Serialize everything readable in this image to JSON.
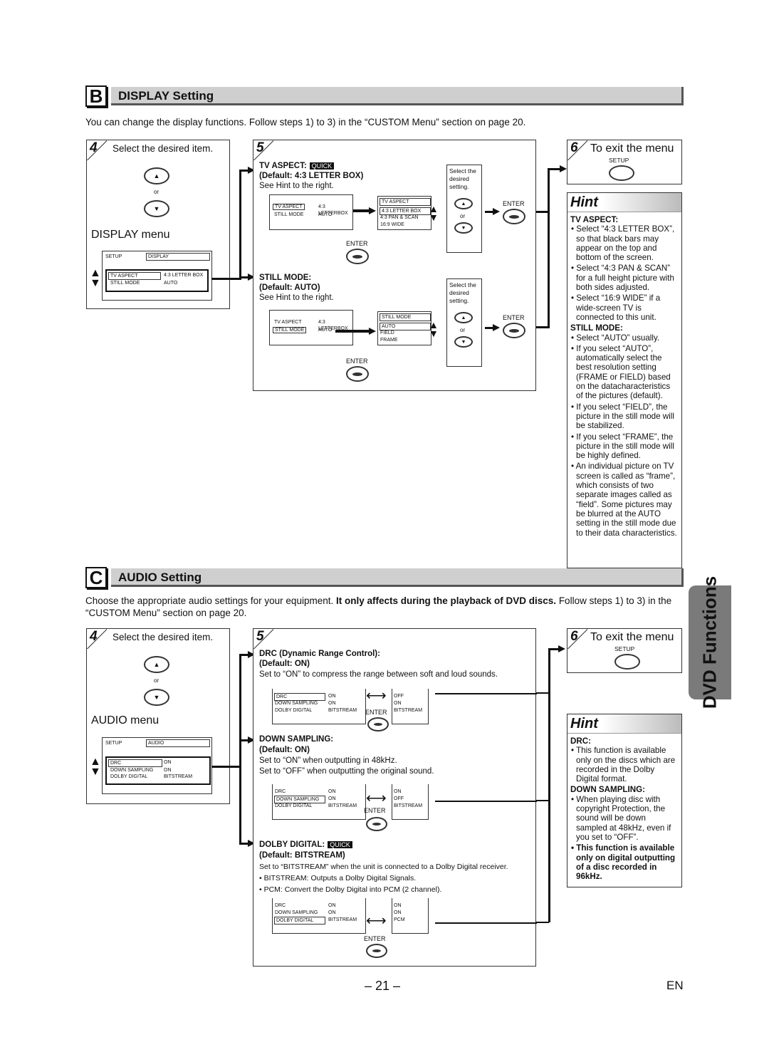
{
  "display_section": {
    "letter": "B",
    "title": "DISPLAY Setting",
    "intro": "You can change the display functions. Follow steps 1) to 3) in the “CUSTOM Menu” section on page 20.",
    "step4": {
      "num": "4",
      "title": "Select the desired item.",
      "or": "or",
      "menu_label": "DISPLAY menu",
      "screen": {
        "setup": "SETUP",
        "tab": "DISPLAY",
        "rows": [
          {
            "item": "TV ASPECT",
            "value": "4:3 LETTER BOX"
          },
          {
            "item": "STILL MODE",
            "value": "AUTO"
          }
        ]
      }
    },
    "step5": {
      "num": "5",
      "tv_aspect": {
        "heading": "TV ASPECT:",
        "quick": "QUICK",
        "default": "(Default: 4:3 LETTER BOX)",
        "note": "See Hint to the right.",
        "screen_rows": [
          {
            "item": "TV ASPECT",
            "value": "4:3 LETTERBOX"
          },
          {
            "item": "STILL MODE",
            "value": "AUTO"
          }
        ],
        "options_title": "TV ASPECT",
        "options": [
          "4:3 LETTER BOX",
          "4:3 PAN & SCAN",
          "16:9 WIDE"
        ],
        "select_text": "Select the desired setting.",
        "or": "or",
        "enter": "ENTER"
      },
      "still_mode": {
        "heading": "STILL MODE:",
        "default": "(Default: AUTO)",
        "note": "See Hint to the right.",
        "screen_rows": [
          {
            "item": "TV ASPECT",
            "value": "4:3 LETTERBOX"
          },
          {
            "item": "STILL MODE",
            "value": "AUTO"
          }
        ],
        "options_title": "STILL MODE",
        "options": [
          "AUTO",
          "FIELD",
          "FRAME"
        ],
        "select_text": "Select the desired setting.",
        "or": "or",
        "enter": "ENTER"
      }
    },
    "step6": {
      "num": "6",
      "title": "To exit the menu",
      "button": "SETUP"
    },
    "hint": {
      "title": "Hint",
      "groups": [
        {
          "heading": "TV ASPECT:",
          "bullets": [
            "Select “4:3 LETTER BOX”, so that black bars may appear on the top and bottom of the screen.",
            "Select “4:3 PAN & SCAN” for a full height picture with both sides adjusted.",
            "Select “16:9 WIDE” if a wide-screen TV is connected to this unit."
          ]
        },
        {
          "heading": "STILL MODE:",
          "bullets": [
            "Select “AUTO” usually.",
            "If you select “AUTO”, automatically select the best resolution setting (FRAME or FIELD) based on the datacharacteristics of the pictures (default).",
            "If you select “FIELD”, the picture in the still mode will be stabilized.",
            "If you select “FRAME”, the picture in the still mode will be highly defined.",
            "An individual picture on TV screen is called as “frame”, which consists of two separate images called as “field”. Some pictures may be blurred at the AUTO setting in the still mode due to their data characteristics."
          ]
        }
      ]
    }
  },
  "audio_section": {
    "letter": "C",
    "title": "AUDIO Setting",
    "intro_plain": "Choose the appropriate audio settings for your equipment. ",
    "intro_bold": "It only affects during the playback of DVD discs.",
    "intro_tail": " Follow steps 1) to 3) in the “CUSTOM Menu” section on page 20.",
    "step4": {
      "num": "4",
      "title": "Select the desired item.",
      "or": "or",
      "menu_label": "AUDIO menu",
      "screen": {
        "setup": "SETUP",
        "tab": "AUDIO",
        "rows": [
          {
            "item": "DRC",
            "value": "ON"
          },
          {
            "item": "DOWN SAMPLING",
            "value": "ON"
          },
          {
            "item": "DOLBY DIGITAL",
            "value": "BITSTREAM"
          }
        ]
      }
    },
    "step5": {
      "num": "5",
      "drc": {
        "heading": "DRC (Dynamic Range Control):",
        "default": "(Default: ON)",
        "desc": "Set to “ON” to compress the range between soft and loud sounds.",
        "left_rows": [
          {
            "item": "DRC",
            "value": "ON"
          },
          {
            "item": "DOWN SAMPLING",
            "value": "ON"
          },
          {
            "item": "DOLBY DIGITAL",
            "value": "BITSTREAM"
          }
        ],
        "right_values": [
          "OFF",
          "ON",
          "BITSTREAM"
        ],
        "enter": "ENTER"
      },
      "down_sampling": {
        "heading": "DOWN SAMPLING:",
        "default": "(Default: ON)",
        "desc1": "Set to “ON” when outputting in 48kHz.",
        "desc2": "Set to “OFF” when outputting the original sound.",
        "left_rows": [
          {
            "item": "DRC",
            "value": "ON"
          },
          {
            "item": "DOWN SAMPLING",
            "value": "ON"
          },
          {
            "item": "DOLBY DIGITAL",
            "value": "BITSTREAM"
          }
        ],
        "right_values": [
          "ON",
          "OFF",
          "BITSTREAM"
        ],
        "enter": "ENTER"
      },
      "dolby": {
        "heading": "DOLBY DIGITAL:",
        "quick": "QUICK",
        "default": "(Default: BITSTREAM)",
        "desc": "Set to “BITSTREAM” when the unit is connected to a Dolby Digital receiver.",
        "bullet1": "• BITSTREAM: Outputs a Dolby Digital Signals.",
        "bullet2": "• PCM: Convert the Dolby Digital into PCM (2 channel).",
        "left_rows": [
          {
            "item": "DRC",
            "value": "ON"
          },
          {
            "item": "DOWN SAMPLING",
            "value": "ON"
          },
          {
            "item": "DOLBY DIGITAL",
            "value": "BITSTREAM"
          }
        ],
        "right_values": [
          "ON",
          "ON",
          "PCM"
        ],
        "enter": "ENTER"
      }
    },
    "step6": {
      "num": "6",
      "title": "To exit the menu",
      "button": "SETUP"
    },
    "hint": {
      "title": "Hint",
      "groups": [
        {
          "heading": "DRC:",
          "bullets": [
            "This function is available only on the discs which are recorded in the Dolby Digital format."
          ]
        },
        {
          "heading": "DOWN SAMPLING:",
          "bullets": [
            "When playing disc with copyright Protection, the sound will be down sampled at 48kHz, even if you set to “OFF”."
          ]
        }
      ],
      "bold_bullet": "This function is available only on digital outputting of a disc recorded in 96kHz."
    }
  },
  "side_tab": "DVD Functions",
  "footer": {
    "page": "– 21 –",
    "lang": "EN"
  }
}
